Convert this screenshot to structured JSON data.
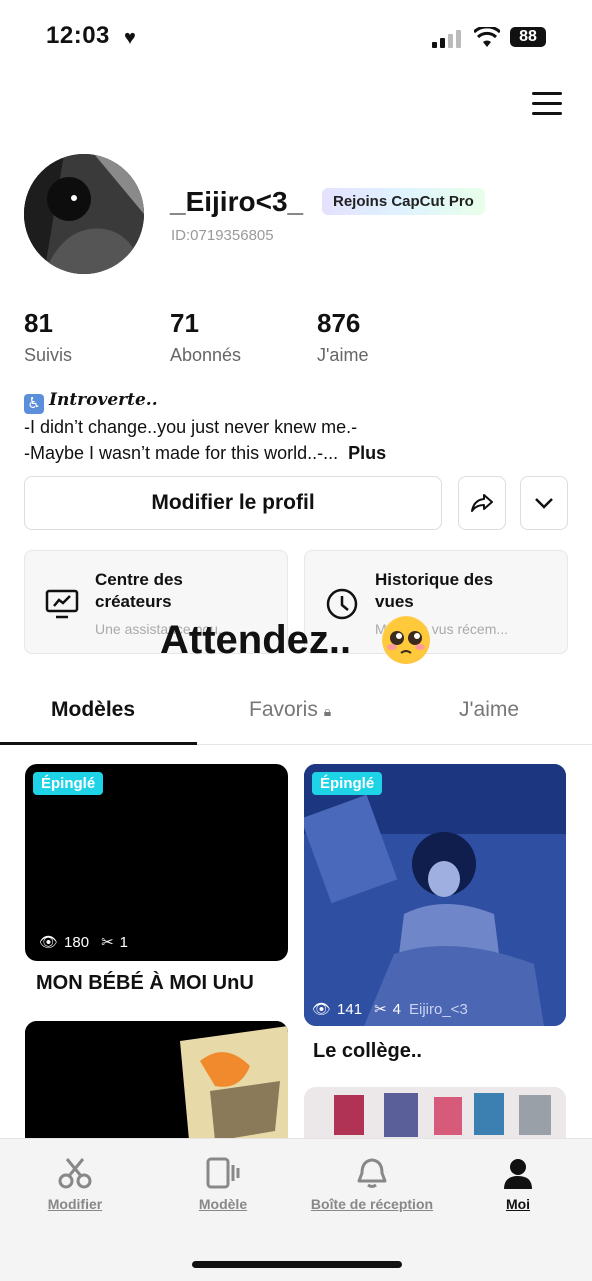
{
  "status_bar": {
    "time": "12:03",
    "battery": "88"
  },
  "profile": {
    "username": "_Eijiro<3_",
    "pro_badge": "Rejoins CapCut Pro",
    "id": "ID:0719356805"
  },
  "stats": [
    {
      "value": "81",
      "label": "Suivis"
    },
    {
      "value": "71",
      "label": "Abonnés"
    },
    {
      "value": "876",
      "label": "J'aime"
    }
  ],
  "bio": {
    "intro": "Introverte..",
    "line1": "-I didn’t change..you just never knew me.-",
    "line2": "-Maybe I wasn’t made for this world..-...",
    "more": "Plus"
  },
  "actions": {
    "edit_profile": "Modifier le profil"
  },
  "cards": [
    {
      "title": "Centre des créateurs",
      "subtitle": "Une assistance pou..."
    },
    {
      "title": "Historique des vues",
      "subtitle": "Modèles vus récem..."
    }
  ],
  "overlay": {
    "text": "Attendez.."
  },
  "tabs": [
    "Modèles",
    "Favoris",
    "J'aime"
  ],
  "templates": [
    {
      "pin": "Épinglé",
      "views": "180",
      "uses": "1",
      "title": "MON BÉBÉ À MOI UnU"
    },
    {
      "pin": "Épinglé",
      "views": "141",
      "uses": "4",
      "title": "Le collège..",
      "watermark": "Eijiro_<3"
    }
  ],
  "bottom_nav": [
    "Modifier",
    "Modèle",
    "Boîte de réception",
    "Moi"
  ],
  "colors": {
    "accent_pin": "#1fd3e6",
    "text": "#111111"
  }
}
